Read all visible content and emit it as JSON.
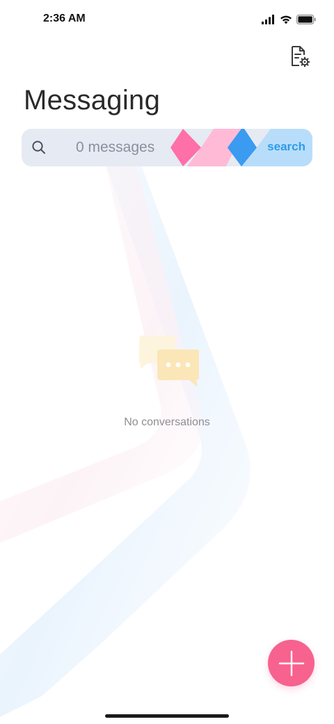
{
  "status_bar": {
    "time": "2:36 AM"
  },
  "header": {
    "title": "Messaging",
    "settings_icon": "document-gear-icon"
  },
  "search": {
    "count_text": "0 messages",
    "action_label": "search",
    "icon": "search-icon"
  },
  "empty_state": {
    "text": "No conversations",
    "icon": "chat-bubbles-icon"
  },
  "fab": {
    "icon": "plus-icon"
  },
  "colors": {
    "accent_pink": "#f7628f",
    "search_action_blue": "#2d9ce6",
    "search_bg": "#e6eaf3",
    "ribbon_pink": "#ff6fa8",
    "ribbon_light_pink": "#ffb7d5",
    "ribbon_blue": "#3a9bf0",
    "ribbon_light_blue": "#b7dcfb"
  }
}
